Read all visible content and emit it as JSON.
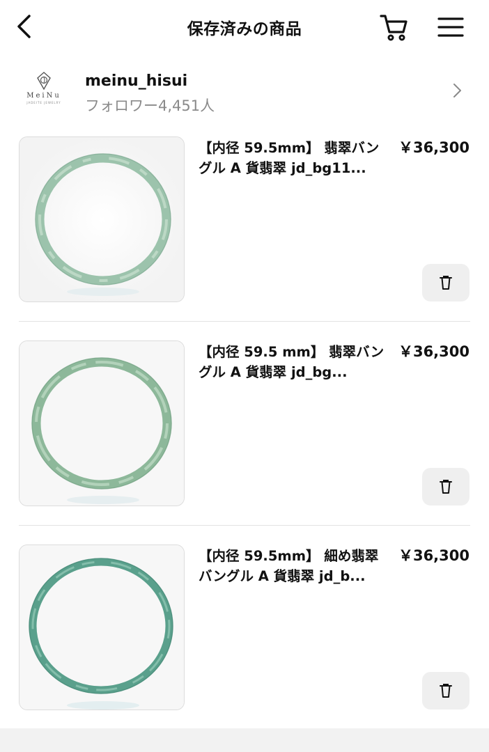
{
  "header": {
    "title": "保存済みの商品",
    "back_icon": "chevron-left-icon",
    "cart_icon": "cart-icon",
    "menu_icon": "hamburger-menu-icon"
  },
  "shop": {
    "logo_text": "MeiNu",
    "logo_subtext": "JADEITE JEWELRY",
    "name": "meinu_hisui",
    "followers": "フォロワー4,451人"
  },
  "products": [
    {
      "title": "【内径 59.5mm】 翡翠バングル A 貨翡翠 jd_bg11...",
      "price": "￥36,300",
      "thumb_color": "#8fb9a2"
    },
    {
      "title": "【内径 59.5 mm】 翡翠バングル A 貨翡翠 jd_bg...",
      "price": "￥36,300",
      "thumb_color": "#86b394"
    },
    {
      "title": "【内径 59.5mm】 細め翡翠バングル A 貨翡翠 jd_b...",
      "price": "￥36,300",
      "thumb_color": "#4f9a86"
    }
  ],
  "colors": {
    "text": "#111111",
    "muted": "#8a8a8a",
    "button_bg": "#efefef"
  }
}
